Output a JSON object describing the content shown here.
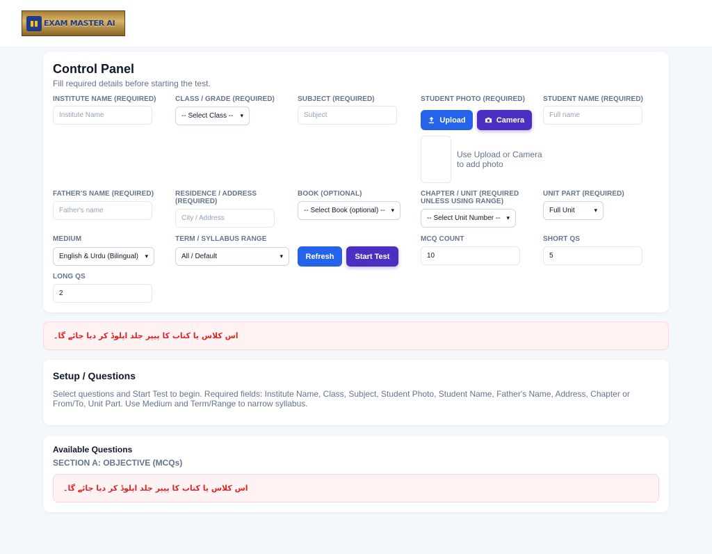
{
  "header": {
    "logo_text": "EXAM MASTER AI"
  },
  "control_panel": {
    "title": "Control Panel",
    "subtitle": "Fill required details before starting the test.",
    "fields": {
      "institute": {
        "label": "INSTITUTE NAME (REQUIRED)",
        "placeholder": "Institute Name"
      },
      "class": {
        "label": "CLASS / GRADE (REQUIRED)",
        "selected": "-- Select Class --"
      },
      "subject": {
        "label": "SUBJECT (REQUIRED)",
        "placeholder": "Subject"
      },
      "photo": {
        "label": "STUDENT PHOTO (REQUIRED)",
        "upload_label": "Upload",
        "camera_label": "Camera",
        "hint": "Use Upload or Camera to add photo"
      },
      "student_name": {
        "label": "STUDENT NAME (REQUIRED)",
        "placeholder": "Full name"
      },
      "father_name": {
        "label": "FATHER'S NAME (REQUIRED)",
        "placeholder": "Father's name"
      },
      "residence": {
        "label": "RESIDENCE / ADDRESS (REQUIRED)",
        "placeholder": "City / Address"
      },
      "book": {
        "label": "BOOK (OPTIONAL)",
        "selected": "-- Select Book (optional) --"
      },
      "chapter": {
        "label": "CHAPTER / UNIT (REQUIRED UNLESS USING RANGE)",
        "selected": "-- Select Unit Number --"
      },
      "unit_part": {
        "label": "UNIT PART (REQUIRED)",
        "selected": "Full Unit"
      },
      "medium": {
        "label": "MEDIUM",
        "selected": "English & Urdu (Bilingual)"
      },
      "term": {
        "label": "TERM / SYLLABUS RANGE",
        "selected": "All / Default"
      },
      "mcq_count": {
        "label": "MCQ COUNT",
        "value": "10"
      },
      "short_qs": {
        "label": "SHORT QS",
        "value": "5"
      },
      "long_qs": {
        "label": "LONG QS",
        "value": "2"
      }
    },
    "refresh_label": "Refresh",
    "start_label": "Start Test"
  },
  "alert_message": "اس کلاس یا کتاب کا پیپر جلد اپلوڈ کر دیا جائے گا۔",
  "setup": {
    "title": "Setup / Questions",
    "text": "Select questions and Start Test to begin. Required fields: Institute Name, Class, Subject, Student Photo, Student Name, Father's Name, Address, Chapter or From/To, Unit Part. Use Medium and Term/Range to narrow syllabus."
  },
  "available": {
    "title": "Available Questions",
    "section": "SECTION A: OBJECTIVE (MCQs)",
    "alert_message": "اس کلاس یا کتاب کا پیپر جلد اپلوڈ کر دیا جائے گا۔"
  },
  "colors": {
    "primary": "#2563eb",
    "accent": "#4c2fc0",
    "alert_text": "#dc2626",
    "alert_bg": "#fef2f2"
  }
}
